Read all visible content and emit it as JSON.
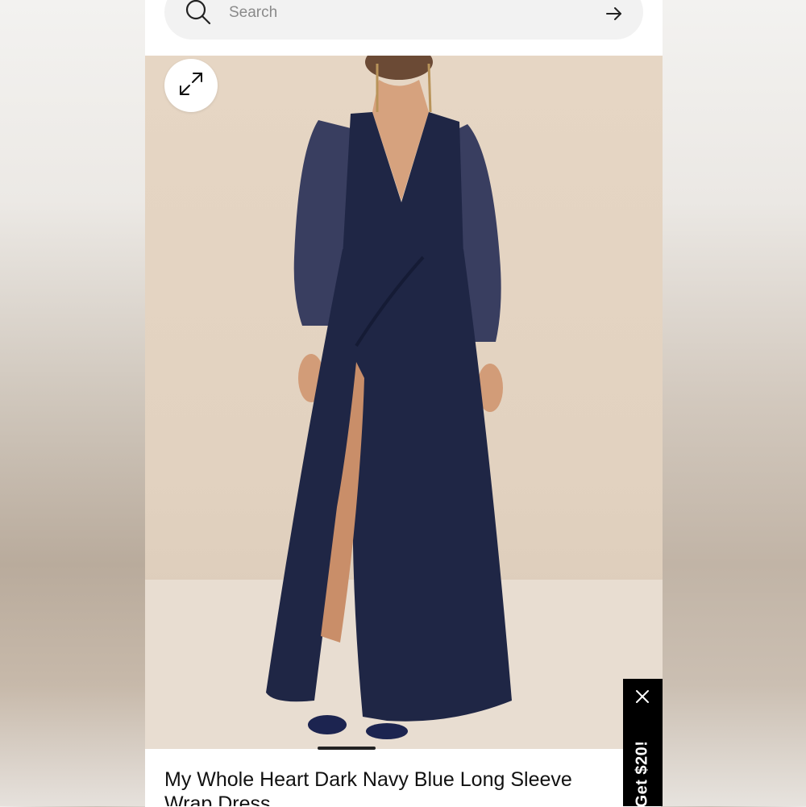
{
  "search": {
    "placeholder": "Search",
    "icon": "search-icon",
    "submit_icon": "arrow-right-icon"
  },
  "gallery": {
    "expand_icon": "expand-icon",
    "image_alt": "Model wearing a dark navy blue long sleeve wrap dress with thigh-high slit and navy heeled sandals"
  },
  "product": {
    "title": "My Whole Heart Dark Navy Blue Long Sleeve Wrap Dress"
  },
  "promo": {
    "label": "Get $20!",
    "close_icon": "close-icon"
  },
  "colors": {
    "dress": "#1f2645",
    "backdrop": "#e4d4c2",
    "promo_bg": "#000000",
    "search_bg": "#f2f2f2"
  }
}
